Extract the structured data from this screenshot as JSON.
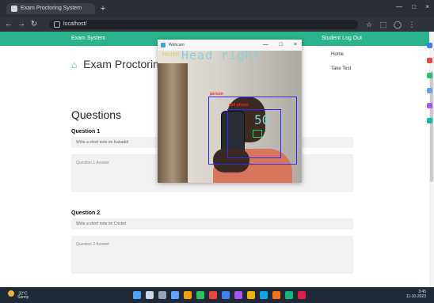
{
  "browser": {
    "tab_title": "Exam Proctoring System",
    "url": "localhost/",
    "new_tab": "+",
    "window_controls": [
      "—",
      "□",
      "×"
    ],
    "nav": {
      "back": "←",
      "forward": "→",
      "reload": "↻"
    },
    "toolbar_icons": [
      "star-icon",
      "extension-icon",
      "profile-icon",
      "menu-icon"
    ]
  },
  "page": {
    "navbar": {
      "brand": "Exam System",
      "right_link": "Student Log Out"
    },
    "title": "Exam Proctoring Syste",
    "right_links": [
      "Home",
      "Take Test"
    ],
    "questions_heading": "Questions",
    "questions": [
      {
        "label": "Question 1",
        "prompt": "Write a short note on Kabaddi",
        "answer_placeholder": "Question 1 Answer"
      },
      {
        "label": "Question 2",
        "prompt": "Write a short note on Cricket",
        "answer_placeholder": "Question 2 Answer"
      }
    ]
  },
  "webcam_window": {
    "title": "Webcam",
    "buttons": [
      "—",
      "□",
      "×"
    ],
    "overlay": {
      "small": "Mouth",
      "head": "Head right",
      "labels": [
        "person",
        "cell phone"
      ],
      "score": "50"
    }
  },
  "taskbar": {
    "weather_temp": "32°C",
    "weather_desc": "Sunny",
    "tray_time": "3:45",
    "tray_date": "11-10-2023"
  },
  "colors": {
    "accent": "#2bb48b",
    "taskbar": "#1f2a36",
    "browser_dark": "#2b2f36"
  }
}
